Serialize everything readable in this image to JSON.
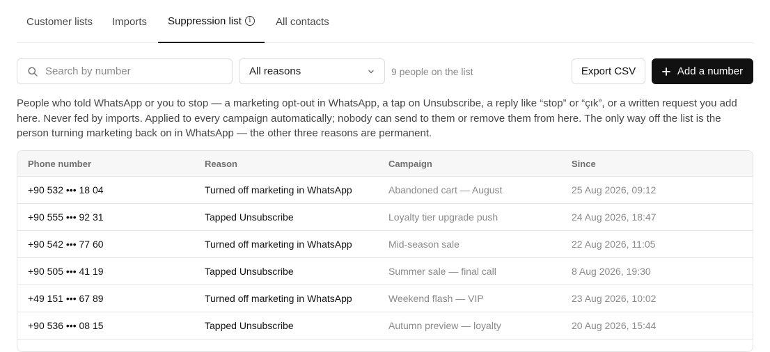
{
  "tabs": [
    {
      "label": "Customer lists",
      "active": false
    },
    {
      "label": "Imports",
      "active": false
    },
    {
      "label": "Suppression list",
      "active": true,
      "icon": "info-icon"
    },
    {
      "label": "All contacts",
      "active": false
    }
  ],
  "toolbar": {
    "search_placeholder": "Search by number",
    "search_value": "",
    "reason_filter": "All reasons",
    "count_text": "9 people on the list",
    "export_label": "Export CSV",
    "add_label": "Add a number"
  },
  "description": "People who told WhatsApp or you to stop — a marketing opt-out in WhatsApp, a tap on Unsubscribe, a reply like “stop” or “çık”, or a written request you add here. Never fed by imports. Applied to every campaign automatically; nobody can send to them or remove them from here. The only way off the list is the person turning marketing back on in WhatsApp — the other three reasons are permanent.",
  "table": {
    "headers": [
      "Phone number",
      "Reason",
      "Campaign",
      "Since"
    ],
    "rows": [
      {
        "phone": "+90 532 ••• 18 04",
        "reason": "Turned off marketing in WhatsApp",
        "campaign": "Abandoned cart — August",
        "since": "25 Aug 2026, 09:12"
      },
      {
        "phone": "+90 555 ••• 92 31",
        "reason": "Tapped Unsubscribe",
        "campaign": "Loyalty tier upgrade push",
        "since": "24 Aug 2026, 18:47"
      },
      {
        "phone": "+90 542 ••• 77 60",
        "reason": "Turned off marketing in WhatsApp",
        "campaign": "Mid-season sale",
        "since": "22 Aug 2026, 11:05"
      },
      {
        "phone": "+90 505 ••• 41 19",
        "reason": "Tapped Unsubscribe",
        "campaign": "Summer sale — final call",
        "since": "8 Aug 2026, 19:30"
      },
      {
        "phone": "+49 151 ••• 67 89",
        "reason": "Turned off marketing in WhatsApp",
        "campaign": "Weekend flash — VIP",
        "since": "23 Aug 2026, 10:02"
      },
      {
        "phone": "+90 536 ••• 08 15",
        "reason": "Tapped Unsubscribe",
        "campaign": "Autumn preview — loyalty",
        "since": "20 Aug 2026, 15:44"
      }
    ]
  },
  "colors": {
    "primary_button": "#111111",
    "muted_text": "#8a8a8a",
    "border": "#e3e3e3"
  }
}
